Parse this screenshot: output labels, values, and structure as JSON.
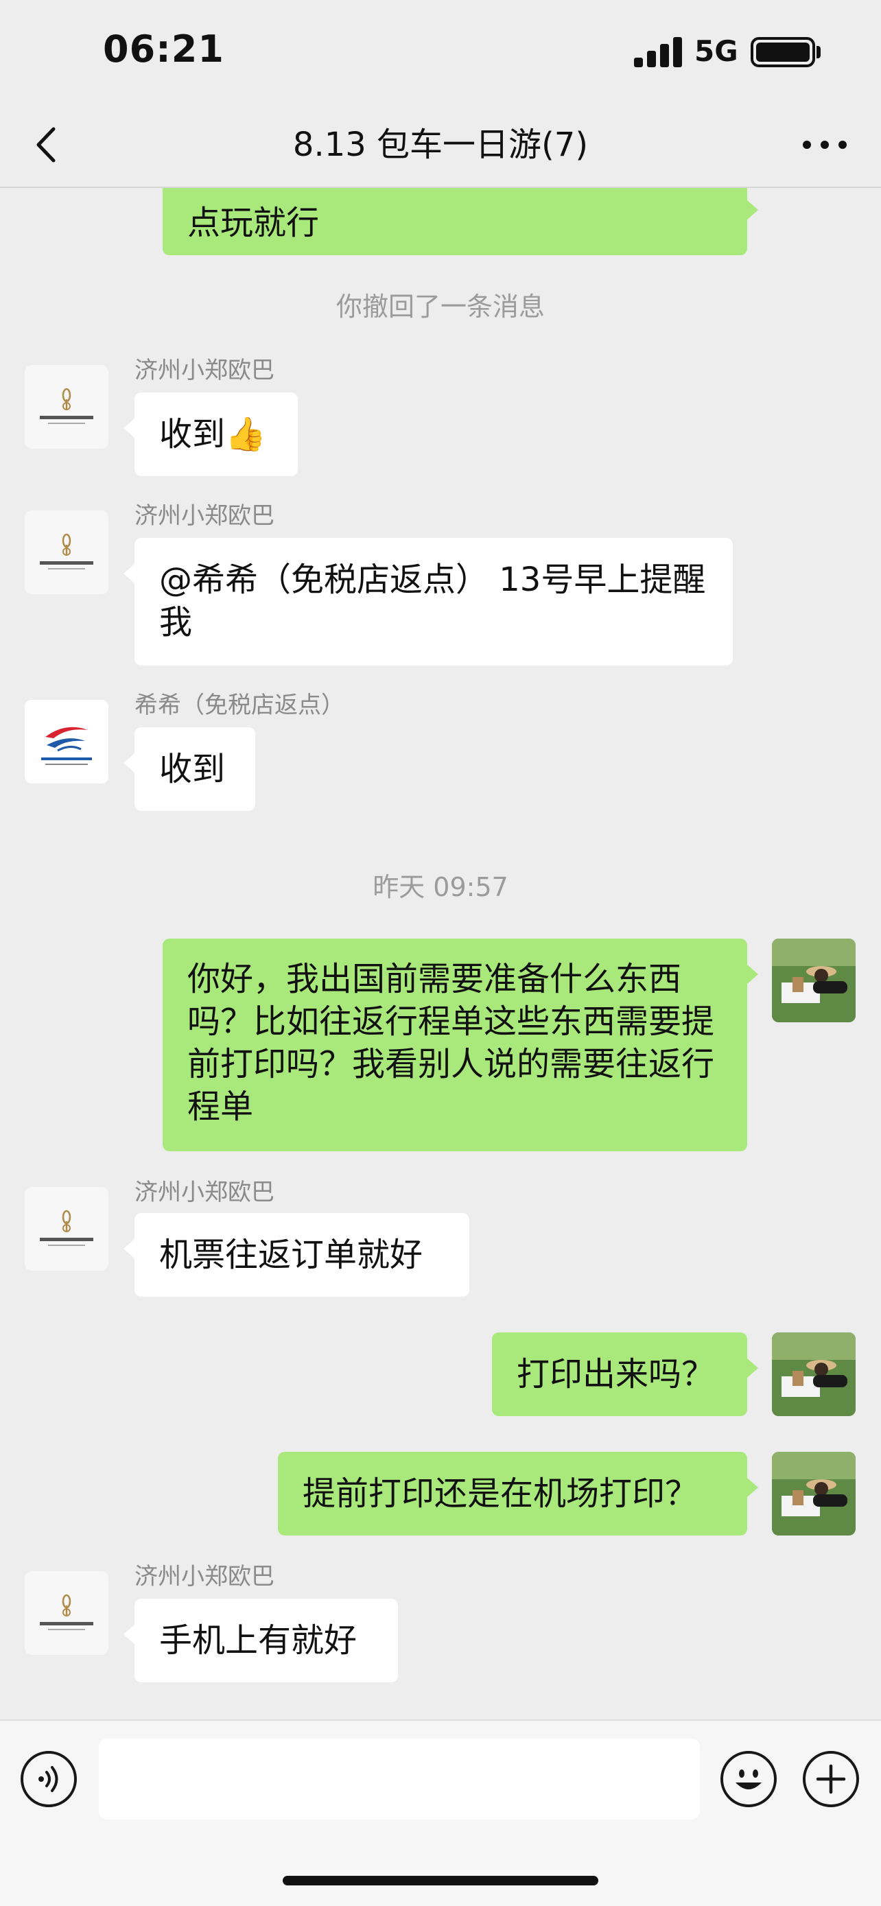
{
  "status_bar": {
    "time": "06:21",
    "network": "5G"
  },
  "header": {
    "title": "8.13 包车一日游(7)"
  },
  "colors": {
    "outgoing_bubble": "#a9e87b",
    "incoming_bubble": "#ffffff",
    "background": "#ededed"
  },
  "messages": {
    "m0": {
      "text": "点玩就行"
    },
    "sys1": {
      "text": "你撤回了一条消息"
    },
    "m1": {
      "sender": "济州小郑欧巴",
      "text": "收到👍"
    },
    "m2": {
      "sender": "济州小郑欧巴",
      "text": "@希希（免税店返点） 13号早上提醒我"
    },
    "m3": {
      "sender": "希希（免税店返点）",
      "text": "收到"
    },
    "time1": {
      "text": "昨天 09:57"
    },
    "m4": {
      "text": "你好，我出国前需要准备什么东西吗？比如往返行程单这些东西需要提前打印吗？我看别人说的需要往返行程单"
    },
    "m5": {
      "sender": "济州小郑欧巴",
      "text": "机票往返订单就好"
    },
    "m6": {
      "text": "打印出来吗？"
    },
    "m7": {
      "text": "提前打印还是在机场打印？"
    },
    "m8": {
      "sender": "济州小郑欧巴",
      "text": "手机上有就好"
    }
  },
  "input_bar": {
    "voice_icon": "voice-icon",
    "emoji_icon": "emoji-icon",
    "add_icon": "plus-icon",
    "value": ""
  }
}
